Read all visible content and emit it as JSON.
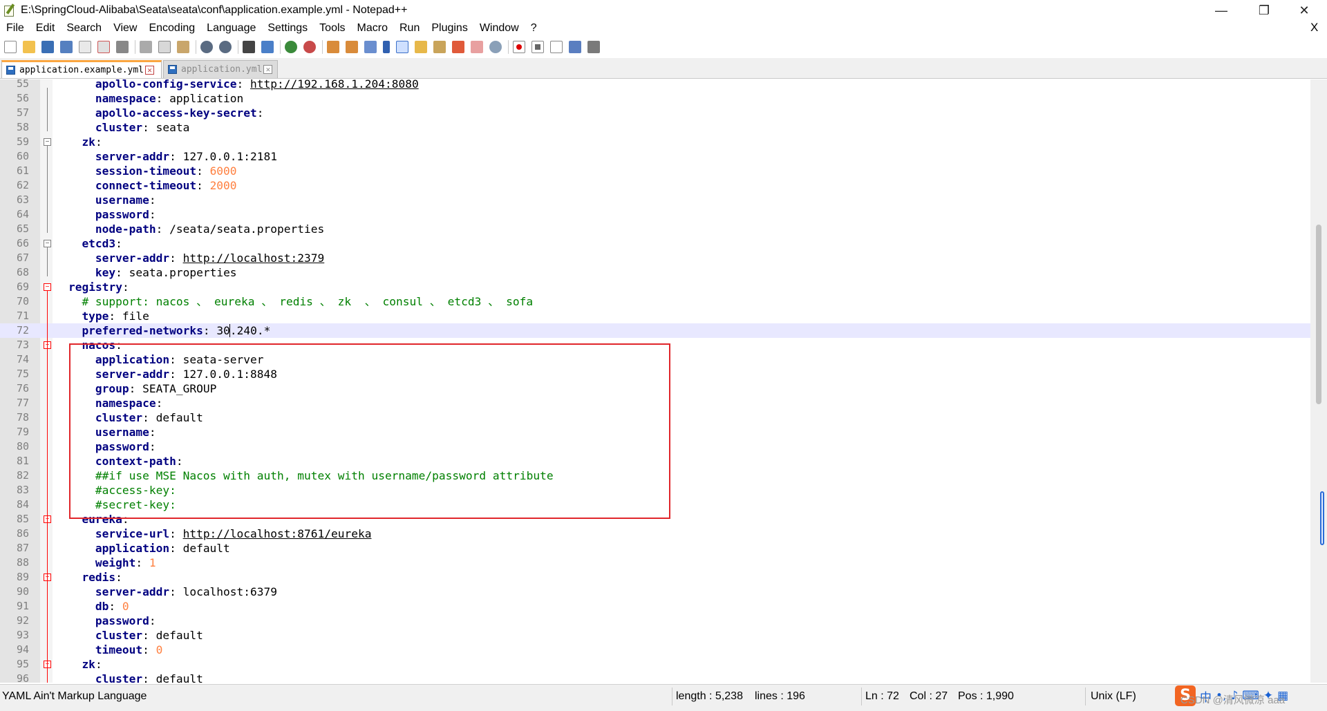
{
  "window": {
    "title": "E:\\SpringCloud-Alibaba\\Seata\\seata\\conf\\application.example.yml - Notepad++",
    "minimize_icon": "—",
    "maximize_icon": "❐",
    "close_icon": "✕"
  },
  "menu": {
    "items": [
      "File",
      "Edit",
      "Search",
      "View",
      "Encoding",
      "Language",
      "Settings",
      "Tools",
      "Macro",
      "Run",
      "Plugins",
      "Window",
      "?"
    ],
    "close_doc": "X"
  },
  "tabs": [
    {
      "label": "application.example.yml",
      "active": true
    },
    {
      "label": "application.yml",
      "active": false
    }
  ],
  "editor": {
    "highlight_color": "#e0252a",
    "lines": [
      {
        "n": "55",
        "indent": 3,
        "key": "apollo-config-service",
        "val": "http://192.168.1.204:8080",
        "type": "url"
      },
      {
        "n": "56",
        "indent": 3,
        "key": "namespace",
        "val": "application",
        "type": "str"
      },
      {
        "n": "57",
        "indent": 3,
        "key": "apollo-access-key-secret",
        "val": "",
        "type": "str"
      },
      {
        "n": "58",
        "indent": 3,
        "key": "cluster",
        "val": "seata",
        "type": "str"
      },
      {
        "n": "59",
        "indent": 2,
        "key": "zk",
        "val": "",
        "type": "str",
        "fold": "minus"
      },
      {
        "n": "60",
        "indent": 3,
        "key": "server-addr",
        "val": "127.0.0.1:2181",
        "type": "str"
      },
      {
        "n": "61",
        "indent": 3,
        "key": "session-timeout",
        "val": "6000",
        "type": "num"
      },
      {
        "n": "62",
        "indent": 3,
        "key": "connect-timeout",
        "val": "2000",
        "type": "num"
      },
      {
        "n": "63",
        "indent": 3,
        "key": "username",
        "val": "",
        "type": "str"
      },
      {
        "n": "64",
        "indent": 3,
        "key": "password",
        "val": "",
        "type": "str"
      },
      {
        "n": "65",
        "indent": 3,
        "key": "node-path",
        "val": "/seata/seata.properties",
        "type": "str"
      },
      {
        "n": "66",
        "indent": 2,
        "key": "etcd3",
        "val": "",
        "type": "str",
        "fold": "minus"
      },
      {
        "n": "67",
        "indent": 3,
        "key": "server-addr",
        "val": "http://localhost:2379",
        "type": "url"
      },
      {
        "n": "68",
        "indent": 3,
        "key": "key",
        "val": "seata.properties",
        "type": "str"
      },
      {
        "n": "69",
        "indent": 1,
        "key": "registry",
        "val": "",
        "type": "str",
        "fold": "minus-red"
      },
      {
        "n": "70",
        "indent": 2,
        "comment": "# support: nacos 、 eureka 、 redis 、 zk  、 consul 、 etcd3 、 sofa"
      },
      {
        "n": "71",
        "indent": 2,
        "key": "type",
        "val": "file",
        "type": "str"
      },
      {
        "n": "72",
        "indent": 2,
        "key": "preferred-networks",
        "val": "30.240.*",
        "type": "str",
        "current": true
      },
      {
        "n": "73",
        "indent": 2,
        "key": "nacos",
        "val": "",
        "type": "str",
        "fold": "minus-red"
      },
      {
        "n": "74",
        "indent": 3,
        "key": "application",
        "val": "seata-server",
        "type": "str"
      },
      {
        "n": "75",
        "indent": 3,
        "key": "server-addr",
        "val": "127.0.0.1:8848",
        "type": "str"
      },
      {
        "n": "76",
        "indent": 3,
        "key": "group",
        "val": "SEATA_GROUP",
        "type": "str"
      },
      {
        "n": "77",
        "indent": 3,
        "key": "namespace",
        "val": "",
        "type": "str"
      },
      {
        "n": "78",
        "indent": 3,
        "key": "cluster",
        "val": "default",
        "type": "str"
      },
      {
        "n": "79",
        "indent": 3,
        "key": "username",
        "val": "",
        "type": "str"
      },
      {
        "n": "80",
        "indent": 3,
        "key": "password",
        "val": "",
        "type": "str"
      },
      {
        "n": "81",
        "indent": 3,
        "key": "context-path",
        "val": "",
        "type": "str"
      },
      {
        "n": "82",
        "indent": 3,
        "comment": "##if use MSE Nacos with auth, mutex with username/password attribute"
      },
      {
        "n": "83",
        "indent": 3,
        "comment": "#access-key:"
      },
      {
        "n": "84",
        "indent": 3,
        "comment": "#secret-key:"
      },
      {
        "n": "85",
        "indent": 2,
        "key": "eureka",
        "val": "",
        "type": "str",
        "fold": "minus-red"
      },
      {
        "n": "86",
        "indent": 3,
        "key": "service-url",
        "val": "http://localhost:8761/eureka",
        "type": "url"
      },
      {
        "n": "87",
        "indent": 3,
        "key": "application",
        "val": "default",
        "type": "str"
      },
      {
        "n": "88",
        "indent": 3,
        "key": "weight",
        "val": "1",
        "type": "num"
      },
      {
        "n": "89",
        "indent": 2,
        "key": "redis",
        "val": "",
        "type": "str",
        "fold": "minus-red"
      },
      {
        "n": "90",
        "indent": 3,
        "key": "server-addr",
        "val": "localhost:6379",
        "type": "str"
      },
      {
        "n": "91",
        "indent": 3,
        "key": "db",
        "val": "0",
        "type": "num"
      },
      {
        "n": "92",
        "indent": 3,
        "key": "password",
        "val": "",
        "type": "str"
      },
      {
        "n": "93",
        "indent": 3,
        "key": "cluster",
        "val": "default",
        "type": "str"
      },
      {
        "n": "94",
        "indent": 3,
        "key": "timeout",
        "val": "0",
        "type": "num"
      },
      {
        "n": "95",
        "indent": 2,
        "key": "zk",
        "val": "",
        "type": "str",
        "fold": "minus-red"
      },
      {
        "n": "96",
        "indent": 3,
        "key": "cluster",
        "val": "default",
        "type": "str"
      }
    ]
  },
  "status": {
    "language": "YAML Ain't Markup Language",
    "length": "length : 5,238",
    "lines": "lines : 196",
    "ln": "Ln : 72",
    "col": "Col : 27",
    "pos": "Pos : 1,990",
    "eol": "Unix (LF)"
  },
  "ime": {
    "logo": "S",
    "lang": "中",
    "icons": [
      "•,",
      "♪",
      "⌨",
      "✦",
      "▦"
    ]
  },
  "watermark": "CSDN @清风微凉 aaa"
}
